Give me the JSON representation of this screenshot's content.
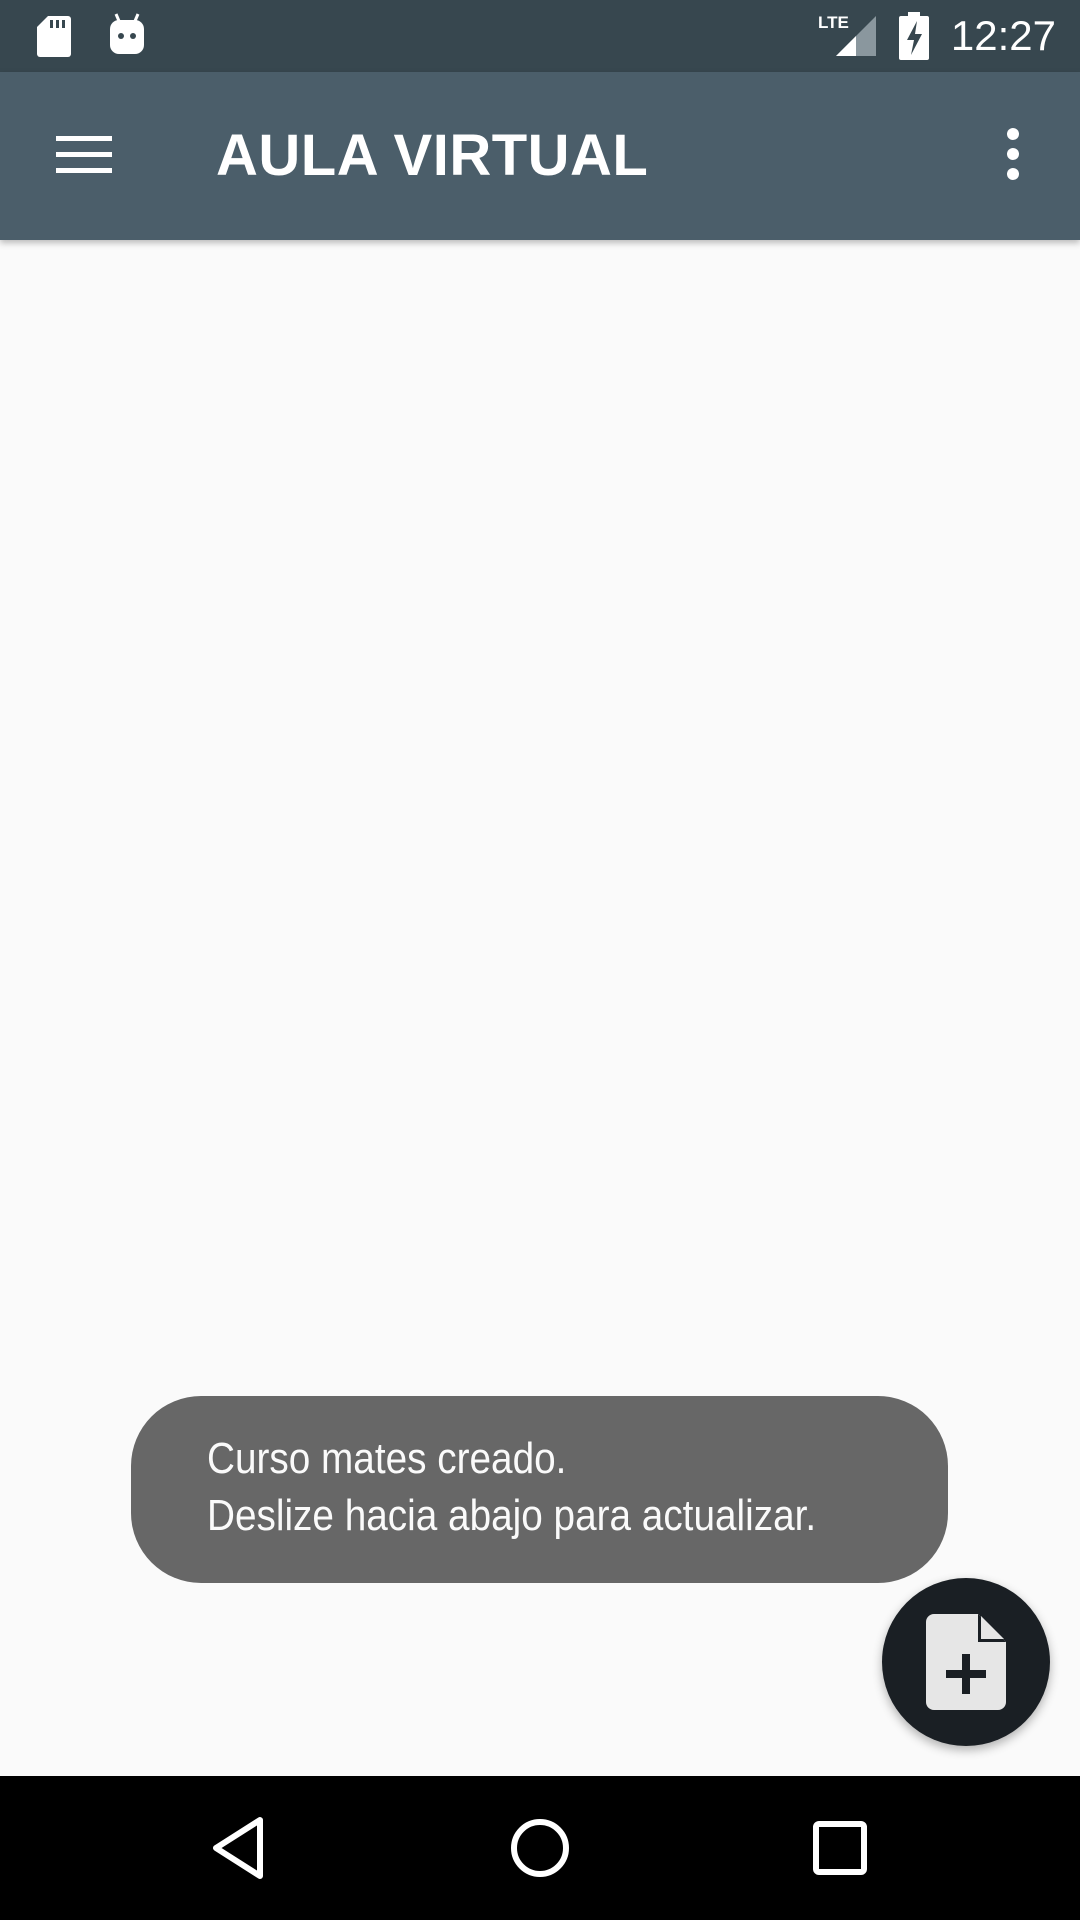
{
  "status_bar": {
    "time": "12:27",
    "network": "LTE",
    "icons": [
      "sd-card-icon",
      "android-icon",
      "lte-signal-icon",
      "battery-charging-icon"
    ]
  },
  "app_bar": {
    "title": "AULA VIRTUAL",
    "background": "#4b5e6a",
    "icons": [
      "hamburger-menu-icon",
      "overflow-menu-icon"
    ]
  },
  "toast": {
    "line1": "Curso mates creado.",
    "line2": "Deslize hacia abajo para actualizar."
  },
  "fab": {
    "icon": "new-document-icon"
  },
  "nav_bar": {
    "icons": [
      "back-icon",
      "home-icon",
      "recents-icon"
    ]
  }
}
